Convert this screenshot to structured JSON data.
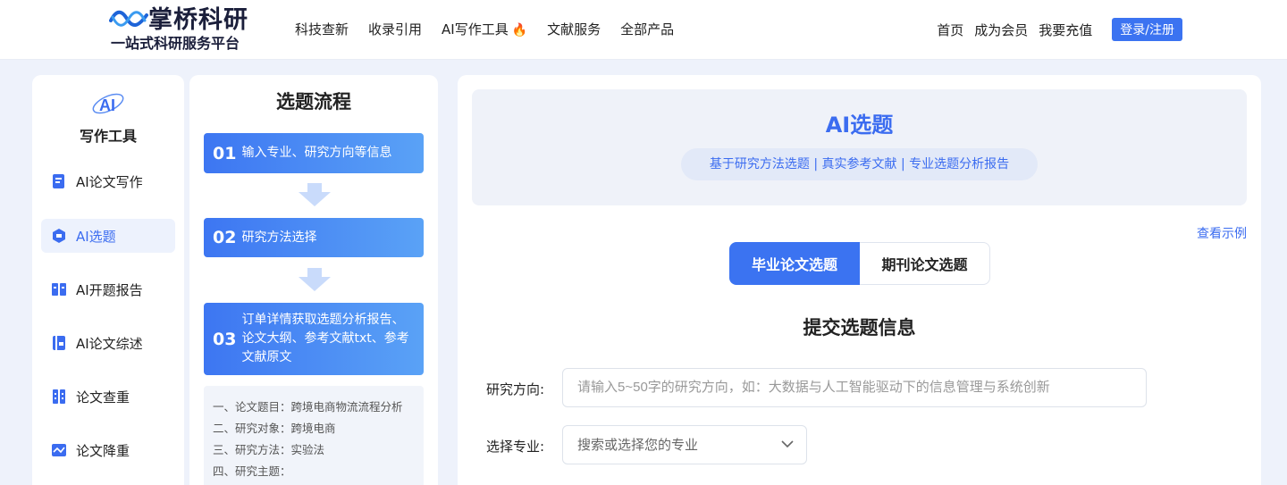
{
  "header": {
    "logo_title": "掌桥科研",
    "logo_sub": "一站式科研服务平台",
    "nav": [
      "科技查新",
      "收录引用",
      "AI写作工具",
      "文献服务",
      "全部产品"
    ],
    "nav_fire": "🔥",
    "right_links": [
      "首页",
      "成为会员",
      "我要充值"
    ],
    "login": "登录/注册"
  },
  "sidebar": {
    "badge": "AI",
    "title": "写作工具",
    "items": [
      {
        "label": "AI论文写作",
        "icon": "document-ai-icon"
      },
      {
        "label": "AI选题",
        "icon": "ai-badge-icon"
      },
      {
        "label": "AI开题报告",
        "icon": "open-book-icon"
      },
      {
        "label": "AI论文综述",
        "icon": "book-ai-icon"
      },
      {
        "label": "论文查重",
        "icon": "grid-check-icon"
      },
      {
        "label": "论文降重",
        "icon": "wave-chart-icon"
      }
    ],
    "active_index": 1
  },
  "process": {
    "title": "选题流程",
    "steps": [
      {
        "num": "01",
        "text": "输入专业、研究方向等信息"
      },
      {
        "num": "02",
        "text": "研究方法选择"
      },
      {
        "num": "03",
        "text": "订单详情获取选题分析报告、论文大纲、参考文献txt、参考 文献原文"
      }
    ],
    "example_lines": [
      "一、论文题目：跨境电商物流流程分析",
      "二、研究对象：跨境电商",
      "三、研究方法：实验法",
      "四、研究主题："
    ]
  },
  "main": {
    "hero_title": "AI选题",
    "hero_features": "基于研究方法选题 | 真实参考文献 | 专业选题分析报告",
    "view_example": "查看示例",
    "tabs": [
      "毕业论文选题",
      "期刊论文选题"
    ],
    "active_tab": 0,
    "form_title": "提交选题信息",
    "direction_label": "研究方向:",
    "direction_placeholder": "请输入5~50字的研究方向，如：大数据与人工智能驱动下的信息管理与系统创新",
    "major_label": "选择专业:",
    "major_placeholder": "搜索或选择您的专业"
  },
  "colors": {
    "accent": "#3b73f1",
    "page_bg": "#eef2fb",
    "fire": "#e8462d"
  }
}
